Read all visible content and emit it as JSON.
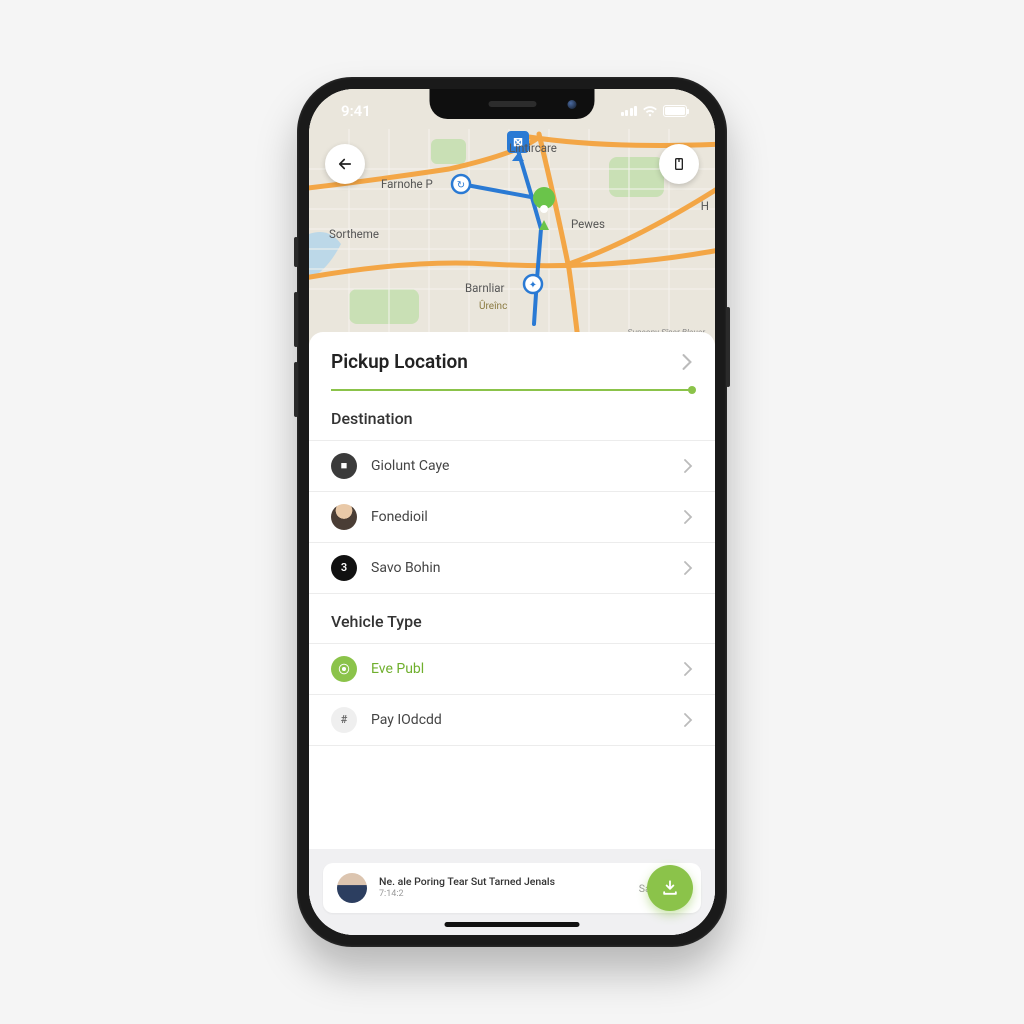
{
  "status": {
    "time": "9:41"
  },
  "map": {
    "labels": {
      "top_center": "Lintircare",
      "left_upper": "Farnohe P",
      "left_mid": "Sortheme",
      "right_mid": "Pewes",
      "bottom_center": "Barnliar",
      "bottom_sub": "Ûreînc",
      "right_edge": "H"
    },
    "attribution": "Suneony Sîner Bleuer"
  },
  "pickup": {
    "title": "Pickup Location"
  },
  "destination": {
    "title": "Destination",
    "items": [
      {
        "label": "Giolunt Caye",
        "badge": "■",
        "variant": "dark"
      },
      {
        "label": "Fonedioil",
        "badge": "",
        "variant": "face"
      },
      {
        "label": "Savo Bohin",
        "badge": "3",
        "variant": "black"
      }
    ]
  },
  "vehicle": {
    "title": "Vehicle Type",
    "items": [
      {
        "label": "Eve Publ",
        "badge": "⦿",
        "variant": "green",
        "label_variant": "green"
      },
      {
        "label": "Pay IOdcdd",
        "badge": "#",
        "variant": "light"
      }
    ]
  },
  "footer": {
    "main": "Ne. ale Poring Tear Sut Tarned Jenals",
    "sub": "7:14:2",
    "action": "Salcbtb"
  },
  "colors": {
    "accent": "#8bc34a"
  }
}
